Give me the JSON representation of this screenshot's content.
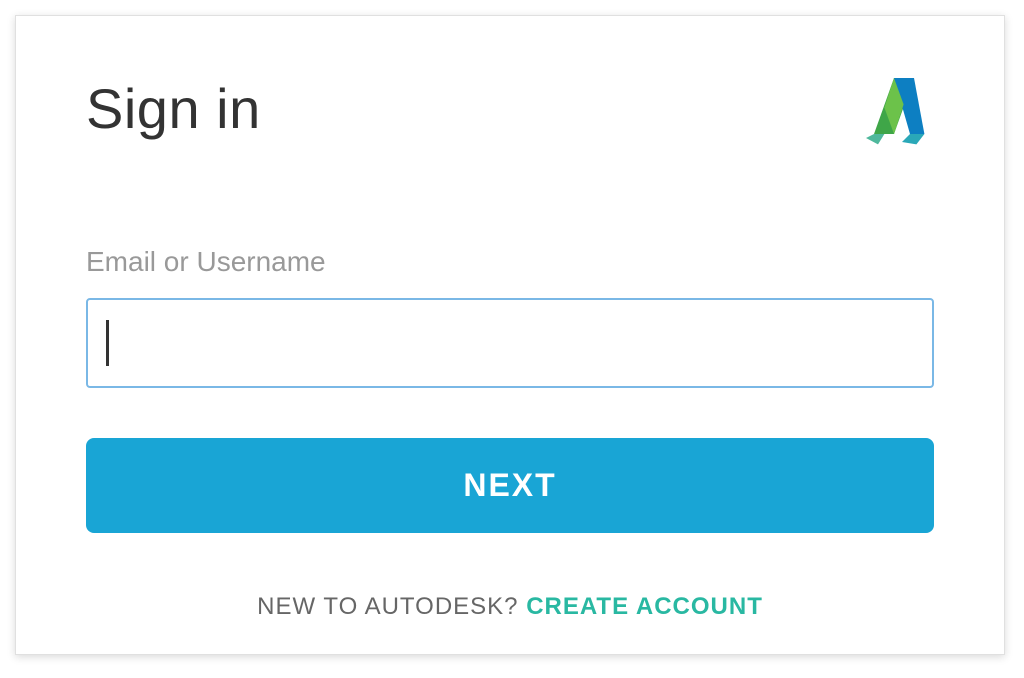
{
  "header": {
    "title": "Sign in"
  },
  "form": {
    "email_label": "Email or Username",
    "email_value": "",
    "next_button_label": "NEXT"
  },
  "footer": {
    "prompt_text": "NEW TO AUTODESK? ",
    "create_link_text": "CREATE ACCOUNT"
  },
  "colors": {
    "accent": "#19a5d5",
    "input_border": "#7ab8e6",
    "link": "#29b8a2"
  }
}
